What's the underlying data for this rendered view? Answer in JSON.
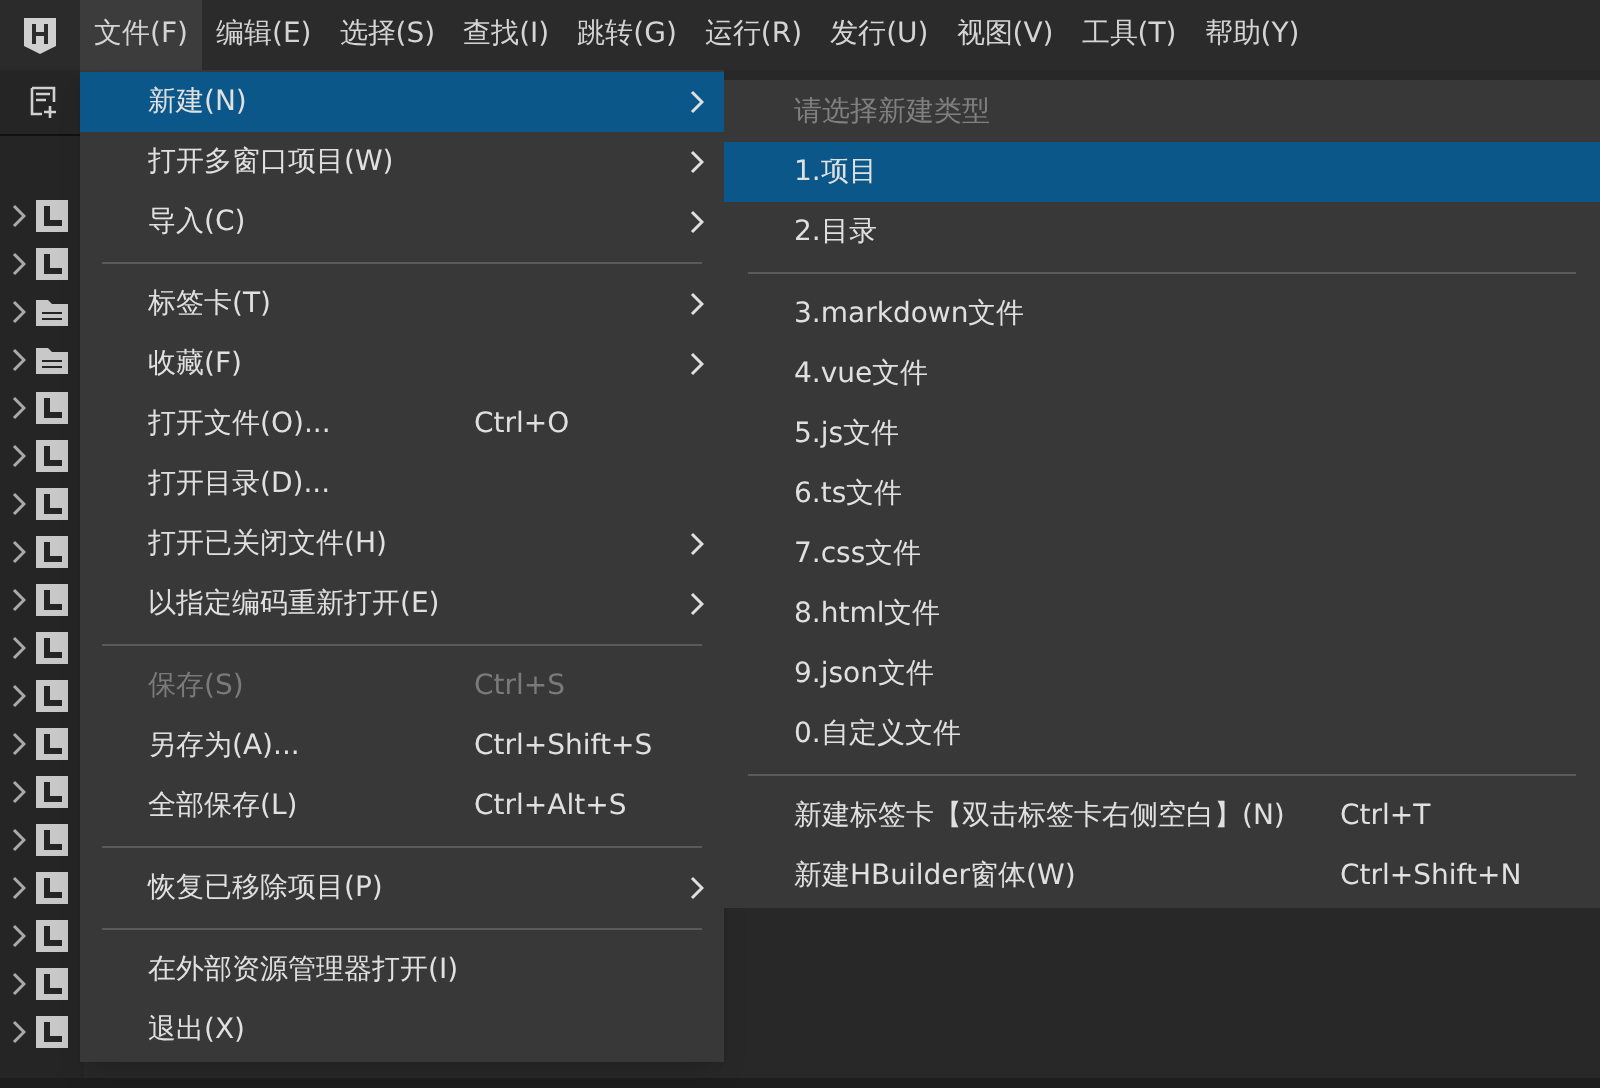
{
  "menu_bar": {
    "items": [
      {
        "label": "文件(F)",
        "selected": true
      },
      {
        "label": "编辑(E)",
        "selected": false
      },
      {
        "label": "选择(S)",
        "selected": false
      },
      {
        "label": "查找(I)",
        "selected": false
      },
      {
        "label": "跳转(G)",
        "selected": false
      },
      {
        "label": "运行(R)",
        "selected": false
      },
      {
        "label": "发行(U)",
        "selected": false
      },
      {
        "label": "视图(V)",
        "selected": false
      },
      {
        "label": "工具(T)",
        "selected": false
      },
      {
        "label": "帮助(Y)",
        "selected": false
      }
    ]
  },
  "sidebar": {
    "items": [
      {
        "kind": "project",
        "expanded": false
      },
      {
        "kind": "project",
        "expanded": false
      },
      {
        "kind": "folder",
        "expanded": false
      },
      {
        "kind": "folder",
        "expanded": false
      },
      {
        "kind": "project",
        "expanded": false
      },
      {
        "kind": "project",
        "expanded": false
      },
      {
        "kind": "project",
        "expanded": false
      },
      {
        "kind": "project",
        "expanded": false
      },
      {
        "kind": "project",
        "expanded": false
      },
      {
        "kind": "project",
        "expanded": false
      },
      {
        "kind": "project",
        "expanded": false
      },
      {
        "kind": "project",
        "expanded": false
      },
      {
        "kind": "project",
        "expanded": false
      },
      {
        "kind": "project",
        "expanded": false
      },
      {
        "kind": "project",
        "expanded": false
      },
      {
        "kind": "project",
        "expanded": false
      },
      {
        "kind": "project",
        "expanded": false
      },
      {
        "kind": "project",
        "expanded": false
      }
    ]
  },
  "file_menu": {
    "items": [
      {
        "kind": "item",
        "label": "新建(N)",
        "submenu": true,
        "selected": true,
        "disabled": false
      },
      {
        "kind": "item",
        "label": "打开多窗口项目(W)",
        "submenu": true,
        "selected": false,
        "disabled": false
      },
      {
        "kind": "item",
        "label": "导入(C)",
        "submenu": true,
        "selected": false,
        "disabled": false
      },
      {
        "kind": "separator"
      },
      {
        "kind": "item",
        "label": "标签卡(T)",
        "submenu": true,
        "selected": false,
        "disabled": false
      },
      {
        "kind": "item",
        "label": "收藏(F)",
        "submenu": true,
        "selected": false,
        "disabled": false
      },
      {
        "kind": "item",
        "label": "打开文件(O)...",
        "shortcut": "Ctrl+O",
        "submenu": false,
        "selected": false,
        "disabled": false
      },
      {
        "kind": "item",
        "label": "打开目录(D)...",
        "submenu": false,
        "selected": false,
        "disabled": false
      },
      {
        "kind": "item",
        "label": "打开已关闭文件(H)",
        "submenu": true,
        "selected": false,
        "disabled": false
      },
      {
        "kind": "item",
        "label": "以指定编码重新打开(E)",
        "submenu": true,
        "selected": false,
        "disabled": false
      },
      {
        "kind": "separator"
      },
      {
        "kind": "item",
        "label": "保存(S)",
        "shortcut": "Ctrl+S",
        "submenu": false,
        "selected": false,
        "disabled": true
      },
      {
        "kind": "item",
        "label": "另存为(A)...",
        "shortcut": "Ctrl+Shift+S",
        "submenu": false,
        "selected": false,
        "disabled": false
      },
      {
        "kind": "item",
        "label": "全部保存(L)",
        "shortcut": "Ctrl+Alt+S",
        "submenu": false,
        "selected": false,
        "disabled": false
      },
      {
        "kind": "separator"
      },
      {
        "kind": "item",
        "label": "恢复已移除项目(P)",
        "submenu": true,
        "selected": false,
        "disabled": false
      },
      {
        "kind": "separator"
      },
      {
        "kind": "item",
        "label": "在外部资源管理器打开(I)",
        "submenu": false,
        "selected": false,
        "disabled": false
      },
      {
        "kind": "item",
        "label": "退出(X)",
        "submenu": false,
        "selected": false,
        "disabled": false
      }
    ]
  },
  "new_submenu": {
    "items": [
      {
        "kind": "header",
        "label": "请选择新建类型"
      },
      {
        "kind": "item",
        "label": "1.项目",
        "selected": true
      },
      {
        "kind": "item",
        "label": "2.目录",
        "selected": false
      },
      {
        "kind": "separator"
      },
      {
        "kind": "item",
        "label": "3.markdown文件",
        "selected": false
      },
      {
        "kind": "item",
        "label": "4.vue文件",
        "selected": false
      },
      {
        "kind": "item",
        "label": "5.js文件",
        "selected": false
      },
      {
        "kind": "item",
        "label": "6.ts文件",
        "selected": false
      },
      {
        "kind": "item",
        "label": "7.css文件",
        "selected": false
      },
      {
        "kind": "item",
        "label": "8.html文件",
        "selected": false
      },
      {
        "kind": "item",
        "label": "9.json文件",
        "selected": false
      },
      {
        "kind": "item",
        "label": "0.自定义文件",
        "selected": false
      },
      {
        "kind": "separator"
      },
      {
        "kind": "item",
        "label": "新建标签卡【双击标签卡右侧空白】(N)",
        "shortcut": "Ctrl+T",
        "selected": false
      },
      {
        "kind": "item",
        "label": "新建HBuilder窗体(W)",
        "shortcut": "Ctrl+Shift+N",
        "selected": false
      }
    ]
  }
}
